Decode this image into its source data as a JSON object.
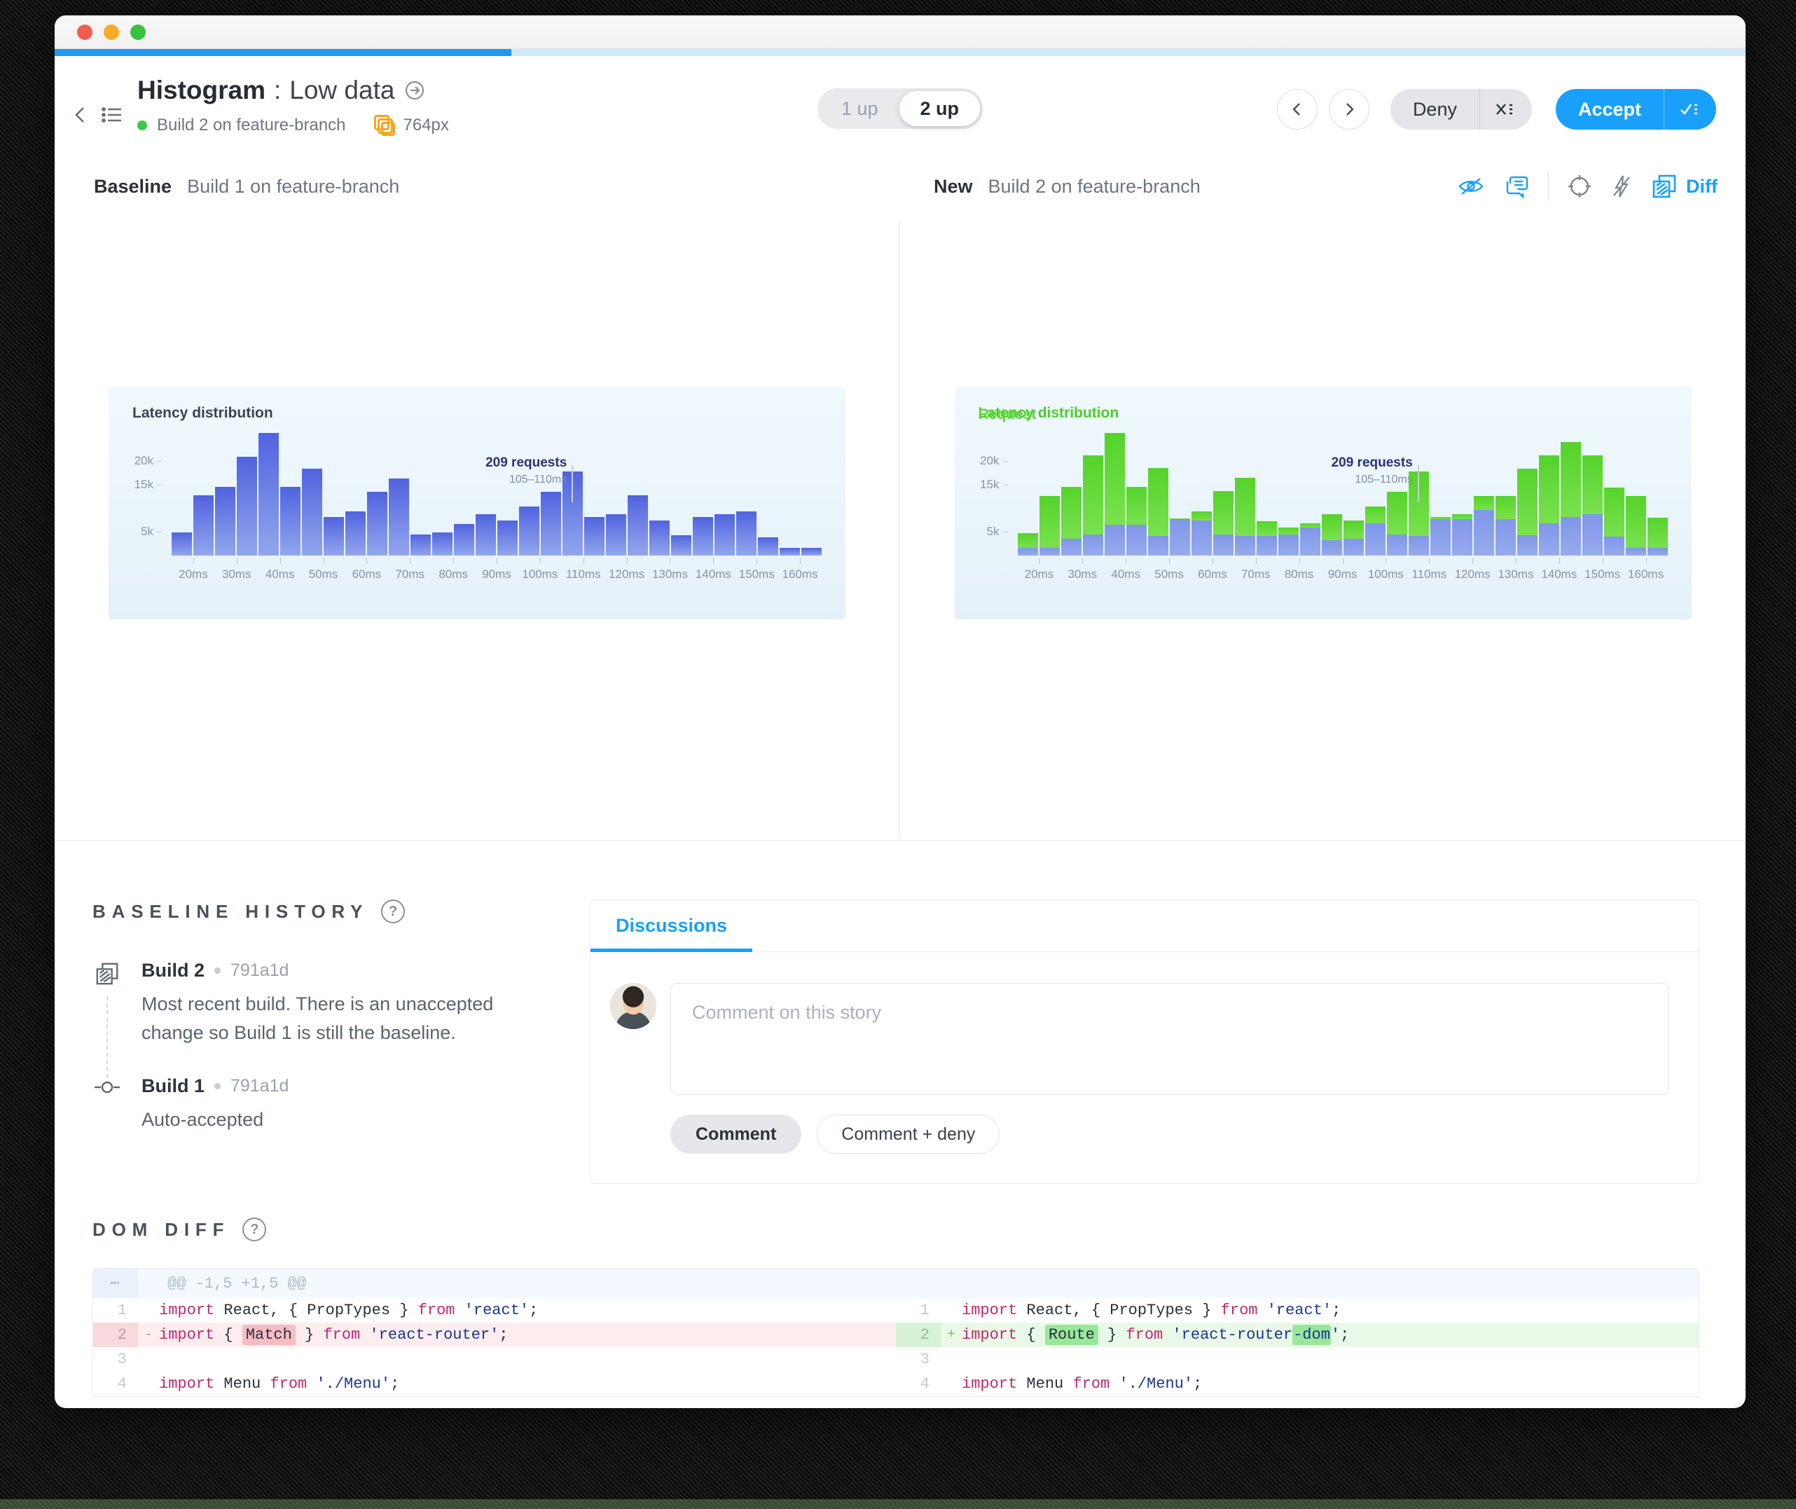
{
  "header": {
    "component": "Histogram",
    "separator": ":",
    "story": "Low data",
    "build_status": "Build 2 on feature-branch",
    "viewport": "764px"
  },
  "view_toggle": {
    "options": [
      "1 up",
      "2 up"
    ],
    "active": "2 up"
  },
  "toolbar": {
    "deny_label": "Deny",
    "accept_label": "Accept"
  },
  "compare": {
    "baseline_label": "Baseline",
    "baseline_build": "Build 1 on feature-branch",
    "new_label": "New",
    "new_build": "Build 2 on feature-branch",
    "diff_label": "Diff"
  },
  "colors": {
    "accent_blue": "#18a0fb",
    "bar_blue_top": "#5063df",
    "bar_blue_bottom": "#92a6ed",
    "diff_green": "#5ed932",
    "progress_fill": "#2396f0"
  },
  "icons": {
    "back": "chevron-left",
    "story_list": "list",
    "story_link": "circled-arrow-right",
    "viewport": "stacked-squares",
    "hide": "eye-off",
    "comments": "chat-bubbles",
    "focus": "crosshair",
    "flash_off": "lightning-off",
    "diff": "diff-squares",
    "help": "?",
    "hunk_ellipsis": "⋯"
  },
  "chart_data": [
    {
      "type": "bar",
      "title": "Latency distribution",
      "xlabel": "",
      "ylabel": "",
      "bins_start_ms": 15,
      "bin_width_ms": 5,
      "x_tick_labels": [
        "20ms",
        "30ms",
        "40ms",
        "50ms",
        "60ms",
        "70ms",
        "80ms",
        "90ms",
        "100ms",
        "110ms",
        "120ms",
        "130ms",
        "140ms",
        "150ms",
        "160ms"
      ],
      "y_ticks": [
        {
          "label": "20k",
          "value": 20
        },
        {
          "label": "15k",
          "value": 15
        },
        {
          "label": "5k",
          "value": 5
        }
      ],
      "y_max_k": 26,
      "values_k": [
        4.9,
        12.8,
        14.6,
        21,
        26,
        14.6,
        18.4,
        8.2,
        9.4,
        13.5,
        16.3,
        4.4,
        4.9,
        6.7,
        8.8,
        7.5,
        10.4,
        13.5,
        17.9,
        8.2,
        8.8,
        12.8,
        7.5,
        4.3,
        8.2,
        8.7,
        9.3,
        3.9,
        1.7,
        1.7
      ],
      "annotation": {
        "label": "209 requests",
        "range": "105–110ms",
        "bar_index": 18
      }
    },
    {
      "type": "bar",
      "title_overlay": [
        "Latency",
        "Request"
      ],
      "title_suffix": " distribution",
      "xlabel": "",
      "ylabel": "",
      "bins_start_ms": 15,
      "bin_width_ms": 5,
      "x_tick_labels": [
        "20ms",
        "30ms",
        "40ms",
        "50ms",
        "60ms",
        "70ms",
        "80ms",
        "90ms",
        "100ms",
        "110ms",
        "120ms",
        "130ms",
        "140ms",
        "150ms",
        "160ms"
      ],
      "y_ticks": [
        {
          "label": "20k",
          "value": 20
        },
        {
          "label": "15k",
          "value": 15
        },
        {
          "label": "5k",
          "value": 5
        }
      ],
      "y_max_k": 26,
      "series": [
        {
          "name": "new-total-changed-green",
          "values_k": [
            4.7,
            12.7,
            14.5,
            21.2,
            26,
            14.5,
            18.5,
            7.9,
            9.3,
            13.7,
            16.5,
            7.3,
            5.9,
            6.9,
            8.7,
            7.4,
            10.4,
            13.5,
            17.9,
            8.2,
            8.7,
            12.6,
            12.6,
            18.4,
            21.2,
            24,
            21.2,
            14.4,
            12.6,
            8.1
          ]
        },
        {
          "name": "unchanged-blue",
          "values_k": [
            1.7,
            1.7,
            3.6,
            4.5,
            6.5,
            6.5,
            4.2,
            7.7,
            7.4,
            4.5,
            4.2,
            4.2,
            4.5,
            5.9,
            3.3,
            3.6,
            6.9,
            4.5,
            4.2,
            7.8,
            7.8,
            9.6,
            7.7,
            4.3,
            6.9,
            8.1,
            8.7,
            4,
            1.7,
            1.7
          ]
        }
      ],
      "annotation": {
        "label": "209 requests",
        "range": "105–110ms",
        "bar_index": 18
      }
    }
  ],
  "baseline_history": {
    "title": "BASELINE HISTORY",
    "items": [
      {
        "name": "Build 2",
        "commit": "791a1d",
        "note": "Most recent build. There is an unaccepted change so Build 1 is still the baseline."
      },
      {
        "name": "Build 1",
        "commit": "791a1d",
        "note": "Auto-accepted"
      }
    ]
  },
  "discussions": {
    "tab": "Discussions",
    "placeholder": "Comment on this story",
    "comment_btn": "Comment",
    "comment_deny_btn": "Comment + deny"
  },
  "dom_diff": {
    "title": "DOM DIFF",
    "hunk": "@@ -1,5 +1,5 @@",
    "left": {
      "lines": [
        {
          "num": 1,
          "type": "ctx",
          "sign": "",
          "segs": [
            [
              "kw",
              "import"
            ],
            [
              "pl",
              " React, { PropTypes } "
            ],
            [
              "kw",
              "from"
            ],
            [
              "pl",
              " "
            ],
            [
              "str",
              "'react'"
            ],
            [
              "pl",
              ";"
            ]
          ]
        },
        {
          "num": 2,
          "type": "del",
          "sign": "-",
          "segs": [
            [
              "kw",
              "import"
            ],
            [
              "pl",
              " { "
            ],
            [
              "hl",
              "Match"
            ],
            [
              "pl",
              " } "
            ],
            [
              "kw",
              "from"
            ],
            [
              "pl",
              " "
            ],
            [
              "str",
              "'react-router'"
            ],
            [
              "pl",
              ";"
            ]
          ]
        },
        {
          "num": 3,
          "type": "ctx",
          "sign": "",
          "segs": []
        },
        {
          "num": 4,
          "type": "ctx",
          "sign": "",
          "segs": [
            [
              "kw",
              "import"
            ],
            [
              "pl",
              " Menu "
            ],
            [
              "kw",
              "from"
            ],
            [
              "pl",
              " "
            ],
            [
              "str",
              "'./Menu'"
            ],
            [
              "pl",
              ";"
            ]
          ]
        }
      ]
    },
    "right": {
      "lines": [
        {
          "num": 1,
          "type": "ctx",
          "sign": "",
          "segs": [
            [
              "kw",
              "import"
            ],
            [
              "pl",
              " React, { PropTypes } "
            ],
            [
              "kw",
              "from"
            ],
            [
              "pl",
              " "
            ],
            [
              "str",
              "'react'"
            ],
            [
              "pl",
              ";"
            ]
          ]
        },
        {
          "num": 2,
          "type": "add",
          "sign": "+",
          "segs": [
            [
              "kw",
              "import"
            ],
            [
              "pl",
              " { "
            ],
            [
              "hl",
              "Route"
            ],
            [
              "pl",
              " } "
            ],
            [
              "kw",
              "from"
            ],
            [
              "pl",
              " "
            ],
            [
              "str",
              "'react-router"
            ],
            [
              "strhl",
              "-dom"
            ],
            [
              "str",
              "'"
            ],
            [
              "pl",
              ";"
            ]
          ]
        },
        {
          "num": 3,
          "type": "ctx",
          "sign": "",
          "segs": []
        },
        {
          "num": 4,
          "type": "ctx",
          "sign": "",
          "segs": [
            [
              "kw",
              "import"
            ],
            [
              "pl",
              " Menu "
            ],
            [
              "kw",
              "from"
            ],
            [
              "pl",
              " "
            ],
            [
              "str",
              "'./Menu'"
            ],
            [
              "pl",
              ";"
            ]
          ]
        }
      ]
    }
  }
}
